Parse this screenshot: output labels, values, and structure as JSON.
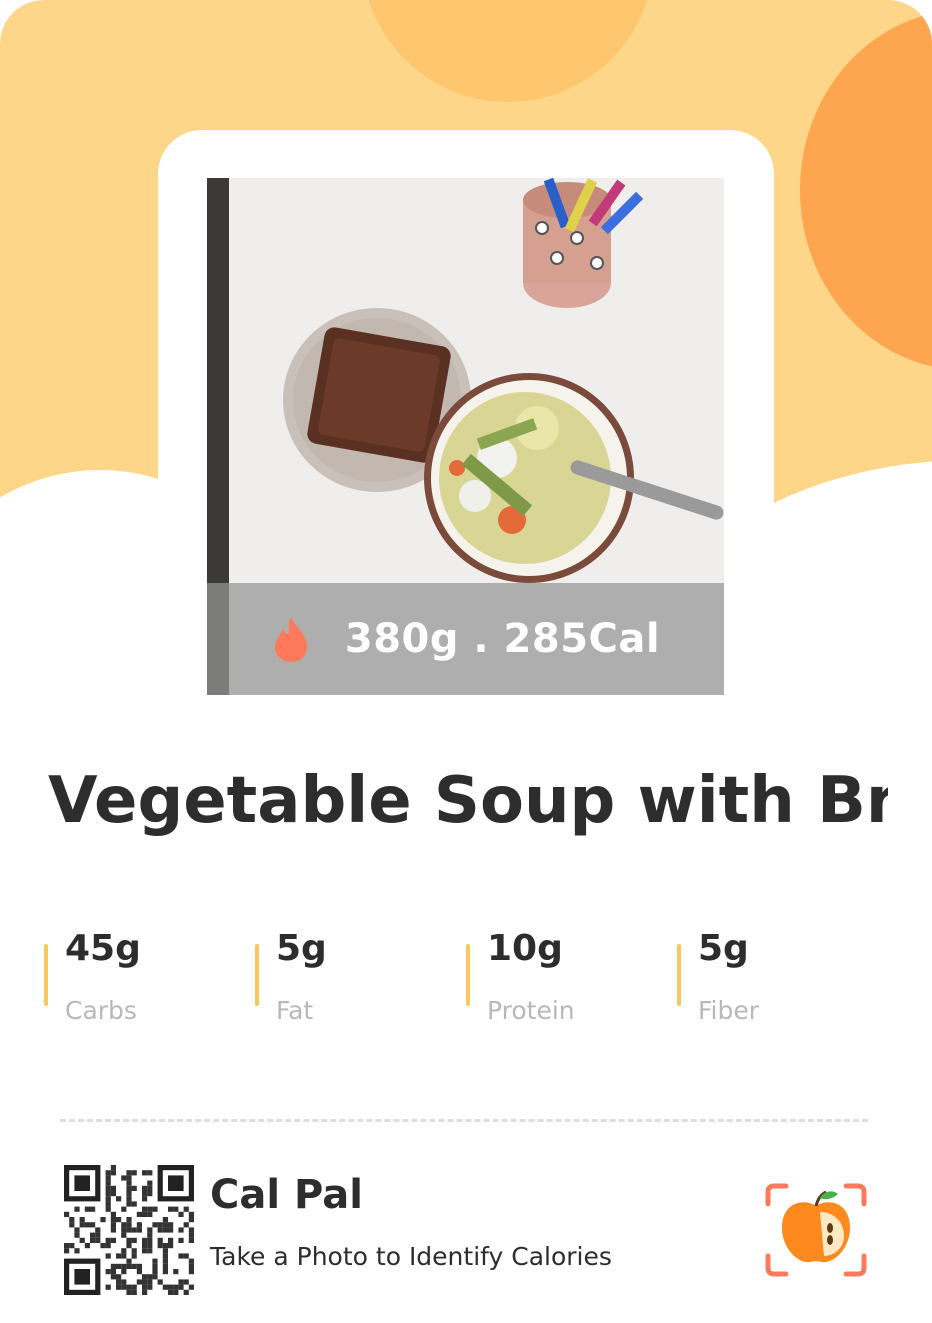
{
  "colors": {
    "background_band": "#fed68a",
    "circle_top": "#fec66f",
    "circle_right": "#fea54f",
    "accent_bar": "#f6c85e",
    "flame": "#fe7a5a",
    "logo_orange": "#fe8a1f"
  },
  "photo": {
    "image": "food-photo-vegetable-soup-bread",
    "stats_icon": "flame-icon",
    "stats_text": "380g . 285Cal"
  },
  "meal": {
    "title": "Vegetable Soup with Br..."
  },
  "macros": [
    {
      "value": "45g",
      "label": "Carbs"
    },
    {
      "value": "5g",
      "label": "Fat"
    },
    {
      "value": "10g",
      "label": "Protein"
    },
    {
      "value": "5g",
      "label": "Fiber"
    }
  ],
  "footer": {
    "qr_icon": "qr-code-icon",
    "brand": "Cal Pal",
    "tagline": "Take a Photo to Identify Calories",
    "logo_icon": "apple-scan-logo-icon"
  }
}
